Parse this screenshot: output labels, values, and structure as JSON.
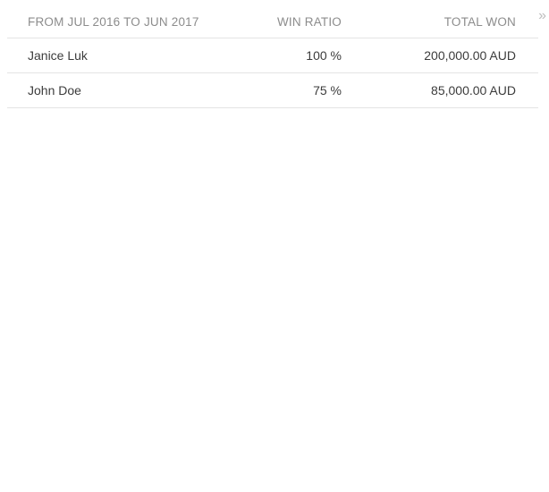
{
  "table": {
    "headers": {
      "period": "FROM JUL 2016 TO JUN 2017",
      "win_ratio": "WIN RATIO",
      "total_won": "TOTAL WON"
    },
    "expand_icon": "double-chevron-right-icon",
    "rows": [
      {
        "name": "Janice Luk",
        "win_ratio": "100 %",
        "total_won": "200,000.00 AUD"
      },
      {
        "name": "John Doe",
        "win_ratio": "75 %",
        "total_won": "85,000.00 AUD"
      }
    ]
  }
}
